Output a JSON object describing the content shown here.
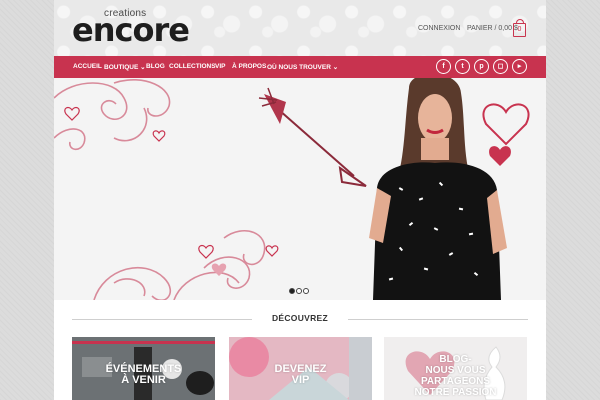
{
  "header": {
    "logo_small": "creations",
    "logo_big": "encore",
    "connexion": "CONNEXION",
    "panier": "PANIER / 0,00 $",
    "cart_count": "0"
  },
  "nav": {
    "items": [
      {
        "label": "ACCUEIL"
      },
      {
        "label": "BOUTIQUE ⌄"
      },
      {
        "label": "BLOG"
      },
      {
        "label": "COLLECTIONS"
      },
      {
        "label": "VIP"
      },
      {
        "label": "À PROPOS"
      },
      {
        "label": "OÙ NOUS TROUVER ⌄"
      }
    ],
    "social": [
      {
        "icon": "facebook-icon",
        "glyph": "f"
      },
      {
        "icon": "twitter-icon",
        "glyph": "t"
      },
      {
        "icon": "pinterest-icon",
        "glyph": "p"
      },
      {
        "icon": "instagram-icon",
        "glyph": "◻"
      },
      {
        "icon": "youtube-icon",
        "glyph": "▸"
      }
    ]
  },
  "slider": {
    "slides_count": 3,
    "active_index": 0
  },
  "section": {
    "title": "DÉCOUVREZ"
  },
  "cards": [
    {
      "lines": [
        "ÉVÉNEMENTS",
        "À VENIR"
      ]
    },
    {
      "lines": [
        "DEVENEZ",
        "VIP"
      ]
    },
    {
      "lines": [
        "BLOG-",
        "NOUS VOUS",
        "PARTAGEONS",
        "NOTRE PASSION"
      ]
    }
  ],
  "colors": {
    "accent": "#c8334f",
    "header_bg": "#e9e9e9",
    "hero_bg": "#f4f4f4"
  }
}
